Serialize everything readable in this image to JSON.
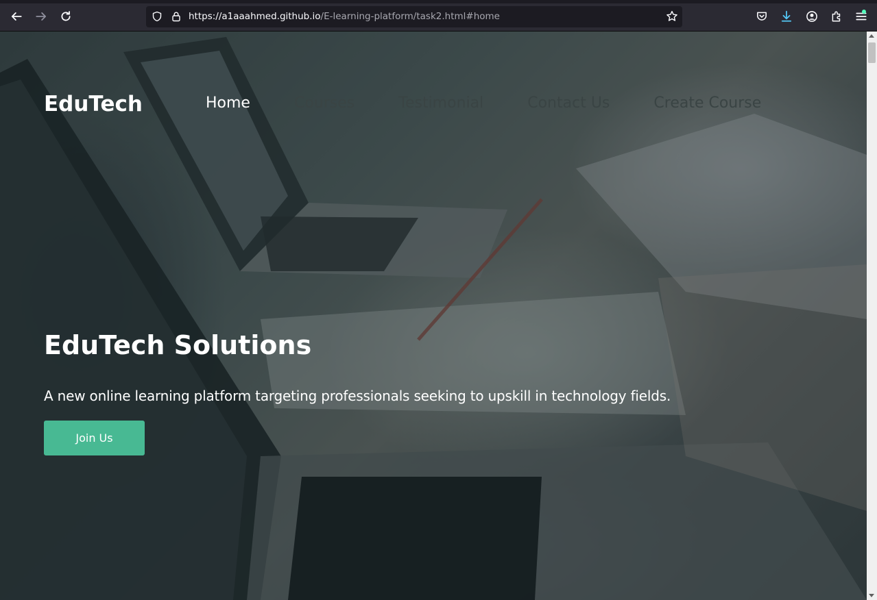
{
  "browser": {
    "url_host": "https://a1aaahmed.github.io",
    "url_path": "/E-learning-platform/task2.html#home",
    "icons": [
      "back-arrow-icon",
      "forward-arrow-icon",
      "reload-icon",
      "shield-icon",
      "lock-icon",
      "bookmark-star-icon",
      "pocket-icon",
      "download-icon",
      "account-icon",
      "extensions-icon",
      "menu-icon"
    ],
    "download_dot_color": "#54ffbd"
  },
  "header": {
    "brand": "EduTech",
    "nav": [
      {
        "label": "Home",
        "active": true
      },
      {
        "label": "Courses",
        "active": false
      },
      {
        "label": "Testimonial",
        "active": false
      },
      {
        "label": "Contact Us",
        "active": false
      },
      {
        "label": "Create Course",
        "active": false
      }
    ]
  },
  "hero": {
    "title": "EduTech Solutions",
    "subtitle": "A new online learning platform targeting professionals seeking to upskill in technology fields.",
    "button_label": "Join Us",
    "button_color": "#48b993"
  }
}
